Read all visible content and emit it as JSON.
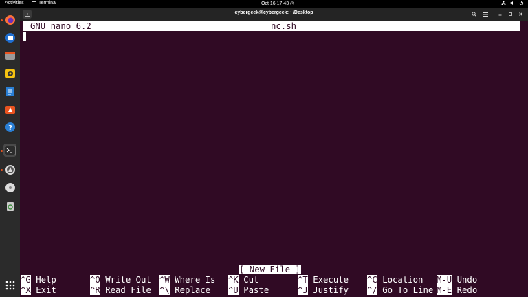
{
  "topbar": {
    "activities": "Activities",
    "app_name": "Terminal",
    "clock": "Oct 16  17:43"
  },
  "window": {
    "title": "cybergeek@cybergeek: ~/Desktop"
  },
  "nano": {
    "version": "GNU nano 6.2",
    "filename": "nc.sh",
    "status": "[ New File ]",
    "shortcuts_row1": [
      {
        "key": "^G",
        "label": "Help"
      },
      {
        "key": "^O",
        "label": "Write Out"
      },
      {
        "key": "^W",
        "label": "Where Is"
      },
      {
        "key": "^K",
        "label": "Cut"
      },
      {
        "key": "^T",
        "label": "Execute"
      },
      {
        "key": "^C",
        "label": "Location"
      },
      {
        "key": "M-U",
        "label": "Undo"
      }
    ],
    "shortcuts_row2": [
      {
        "key": "^X",
        "label": "Exit"
      },
      {
        "key": "^R",
        "label": "Read File"
      },
      {
        "key": "^\\",
        "label": "Replace"
      },
      {
        "key": "^U",
        "label": "Paste"
      },
      {
        "key": "^J",
        "label": "Justify"
      },
      {
        "key": "^/",
        "label": "Go To Line"
      },
      {
        "key": "M-E",
        "label": "Redo"
      }
    ]
  },
  "dock": [
    "firefox-icon",
    "thunderbird-icon",
    "files-icon",
    "rhythmbox-icon",
    "writer-icon",
    "software-icon",
    "help-icon",
    "terminal-icon",
    "updater-icon",
    "dvd-icon",
    "trash-icon",
    "app-grid-icon"
  ],
  "colors": {
    "terminal_bg": "#300a24",
    "accent": "#e95420"
  }
}
